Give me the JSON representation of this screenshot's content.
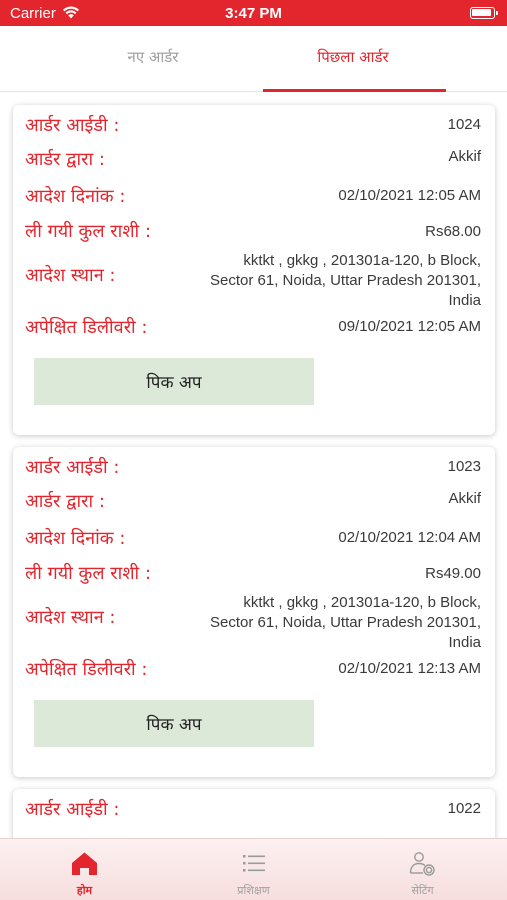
{
  "status_bar": {
    "carrier": "Carrier",
    "time": "3:47 PM"
  },
  "tabs": [
    {
      "label": "नए आर्डर",
      "active": false
    },
    {
      "label": "पिछला आर्डर",
      "active": true
    }
  ],
  "field_labels": {
    "order_id": "आर्डर आईडी :",
    "ordered_by": "आर्डर द्वारा :",
    "order_date": "आदेश दिनांक :",
    "amount": "ली गयी कुल राशी :",
    "location": "आदेश स्थान :",
    "expected_delivery": "अपेक्षित डिलीवरी :"
  },
  "pickup_label": "पिक अप",
  "orders": [
    {
      "id": "1024",
      "by": "Akkif",
      "date": "02/10/2021 12:05 AM",
      "amount": "Rs68.00",
      "address": [
        "kktkt , gkkg , 201301a-120, b Block,",
        "Sector 61, Noida, Uttar Pradesh 201301,",
        "India"
      ],
      "delivery": "09/10/2021 12:05 AM"
    },
    {
      "id": "1023",
      "by": "Akkif",
      "date": "02/10/2021 12:04 AM",
      "amount": "Rs49.00",
      "address": [
        "kktkt , gkkg , 201301a-120, b Block,",
        "Sector 61, Noida, Uttar Pradesh 201301,",
        "India"
      ],
      "delivery": "02/10/2021 12:13 AM"
    },
    {
      "id": "1022"
    }
  ],
  "bottom_nav": [
    {
      "label": "होम",
      "icon": "home-icon",
      "active": true
    },
    {
      "label": "प्रशिक्षण",
      "icon": "list-icon",
      "active": false
    },
    {
      "label": "सेटिंग",
      "icon": "user-settings-icon",
      "active": false
    }
  ],
  "colors": {
    "primary": "#e3262e",
    "pickup_bg": "#dde9d8",
    "inactive": "#9e9e9e"
  }
}
